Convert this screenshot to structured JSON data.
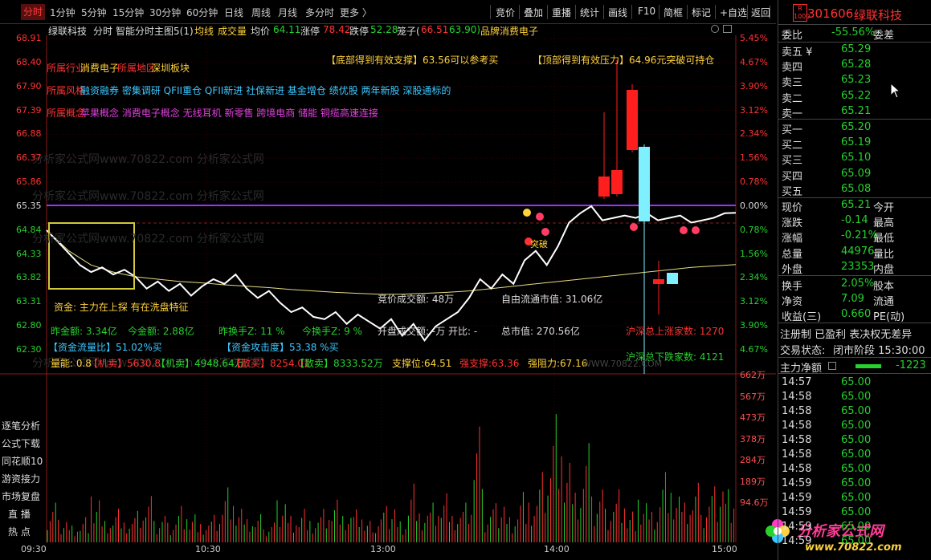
{
  "topbar": {
    "tabs": [
      "分时",
      "1分钟",
      "5分钟",
      "15分钟",
      "30分钟",
      "60分钟",
      "日线",
      "周线",
      "月线",
      "多分时",
      "更多 〉"
    ],
    "tools": [
      "竞价",
      "叠加",
      "重播",
      "统计",
      "画线",
      "F10",
      "简框",
      "标记",
      "+自选",
      "返回"
    ]
  },
  "info": {
    "stock_name": "绿联科技",
    "mode": "分时",
    "indicator": "智能分时主图5(1)",
    "avg_line": "均线",
    "vol_label": "成交量",
    "avg_price_label": "均价",
    "avg_price": "64.11",
    "limit_up_label": "涨停",
    "limit_up": "78.42",
    "limit_down_label": "跌停",
    "limit_down": "52.28",
    "cage_label": "笼子(",
    "cage_low": "66.51",
    "cage_high": "63.90)",
    "brand": "品牌消费电子"
  },
  "price_axis_left": [
    "68.91",
    "68.40",
    "67.90",
    "67.39",
    "66.88",
    "66.37",
    "65.86",
    "65.35",
    "64.84",
    "64.33",
    "63.82",
    "63.31",
    "62.80",
    "62.30"
  ],
  "pct_axis_right": [
    "5.45%",
    "4.67%",
    "3.90%",
    "3.12%",
    "2.34%",
    "1.56%",
    "0.78%",
    "0.00%",
    "0.78%",
    "1.56%",
    "2.34%",
    "3.12%",
    "3.90%",
    "4.67%"
  ],
  "vol_axis": [
    "662万",
    "567万",
    "473万",
    "378万",
    "284万",
    "189万",
    "94.6万"
  ],
  "time_axis": [
    "09:30",
    "10:30",
    "13:00",
    "14:00",
    "15:00"
  ],
  "annotations": {
    "industry_label": "所属行业",
    "industry": "消费电子",
    "region_label": "所属地区",
    "region": "深圳板块",
    "style_label": "所属风格",
    "styles": "融资融券 密集调研 QFII重仓 QFII新进 社保新进 基金增仓 绩优股 两年新股 深股通标的",
    "concept_label": "所属概念",
    "concepts": "苹果概念 消费电子概念 无线耳机 新零售 跨境电商 储能 铜缆高速连接",
    "support_text": "【底部得到有效支撑】63.56可以参考买",
    "pressure_text": "【顶部得到有效压力】64.96元突破可持仓",
    "fund_text": "资金: 主力在上探  有在洗盘特征",
    "today_amount": "昨金额: 3.34亿",
    "today_amount2": "今金额: 2.88亿",
    "yest_turnover": "昨换手Z: 11 %",
    "today_turnover": "今换手Z: 9 %",
    "fund_flow": "【资金流量比】51.02%买",
    "fund_attack": "【资金攻击度】53.38 %买",
    "vol_ratio": "量能: 0.8",
    "big_sell": "【机卖】5630.8",
    "big_buy": "【机卖】4948.64万",
    "retail_buy": "【散买】8254.01",
    "retail_sell": "【散卖】8333.52万",
    "support_line": "支撑位:64.51",
    "strong_support": "强支撑:63.36",
    "strong_resist": "强阻力:67.16",
    "auction_amount": "竞价成交额: 48万",
    "open_amount": "开盘成交额: -万 开比: -",
    "float_value": "自由流通市值: 31.06亿",
    "total_value": "总市值: 270.56亿",
    "up_count": "沪深总上涨家数: 1270",
    "down_count": "沪深总下跌家数: 4121",
    "breakout": "突破",
    "watermark_url": "WWW.70822.COM",
    "watermark": "分析家公式网www.70822.com 分析家公式网"
  },
  "left_menu": [
    "逐笔分析",
    "公式下载",
    "同花顺10",
    "游资接力",
    "市场复盘",
    "直 播",
    "热 点"
  ],
  "right_panel": {
    "code": "301606",
    "name": "绿联科技",
    "ratio_label": "委比",
    "ratio": "-55.56%",
    "diff_label": "委差",
    "asks": [
      {
        "label": "卖五 ¥",
        "price": "65.29"
      },
      {
        "label": "卖四",
        "price": "65.28"
      },
      {
        "label": "卖三",
        "price": "65.23"
      },
      {
        "label": "卖二",
        "price": "65.22"
      },
      {
        "label": "卖一",
        "price": "65.21"
      }
    ],
    "bids": [
      {
        "label": "买一",
        "price": "65.20"
      },
      {
        "label": "买二",
        "price": "65.19"
      },
      {
        "label": "买三",
        "price": "65.10"
      },
      {
        "label": "买四",
        "price": "65.09"
      },
      {
        "label": "买五",
        "price": "65.08"
      }
    ],
    "stats": [
      {
        "k": "现价",
        "v": "65.21",
        "k2": "今开"
      },
      {
        "k": "涨跌",
        "v": "-0.14",
        "k2": "最高"
      },
      {
        "k": "涨幅",
        "v": "-0.21%",
        "k2": "最低"
      },
      {
        "k": "总量",
        "v": "44976",
        "k2": "量比"
      },
      {
        "k": "外盘",
        "v": "23353",
        "k2": "内盘"
      }
    ],
    "stats2": [
      {
        "k": "换手",
        "v": "2.05%",
        "k2": "股本"
      },
      {
        "k": "净资",
        "v": "7.09",
        "k2": "流通"
      },
      {
        "k": "收益(三)",
        "v": "0.660",
        "k2": "PE(动)"
      }
    ],
    "tags": "注册制 已盈利 表决权无差异",
    "trade_status_label": "交易状态:",
    "trade_status": "闭市阶段 15:30:00",
    "net_label": "主力净额",
    "net_value": "-1223",
    "ticks": [
      {
        "t": "14:57",
        "p": "65.00"
      },
      {
        "t": "14:58",
        "p": "65.00"
      },
      {
        "t": "14:58",
        "p": "65.00"
      },
      {
        "t": "14:58",
        "p": "65.00"
      },
      {
        "t": "14:58",
        "p": "65.00"
      },
      {
        "t": "14:58",
        "p": "65.00"
      },
      {
        "t": "14:58",
        "p": "65.00"
      },
      {
        "t": "14:59",
        "p": "65.00"
      },
      {
        "t": "14:59",
        "p": "65.00"
      },
      {
        "t": "14:59",
        "p": "65.00"
      },
      {
        "t": "14:59",
        "p": "65.00"
      },
      {
        "t": "14:59",
        "p": "65.00"
      }
    ]
  },
  "logo": {
    "text": "分析家公式网",
    "url": "www.70822.com"
  },
  "colors": {
    "up": "#ff3232",
    "down": "#27d12e",
    "yellow": "#ffd23c",
    "cyan": "#3cc8ff",
    "magenta": "#e040e0",
    "baseline": "#9933ff"
  },
  "chart_data": {
    "type": "line",
    "title": "",
    "price_series": [
      64.84,
      64.6,
      64.35,
      64.1,
      63.95,
      64.05,
      63.9,
      64.0,
      63.85,
      63.6,
      63.75,
      63.55,
      63.7,
      63.45,
      63.65,
      63.8,
      63.7,
      63.9,
      63.6,
      63.4,
      63.55,
      63.3,
      63.1,
      63.2,
      63.0,
      62.95,
      63.1,
      62.85,
      63.05,
      62.9,
      62.75,
      62.95,
      62.6,
      62.85,
      62.5,
      62.8,
      62.95,
      63.1,
      63.4,
      63.8,
      63.6,
      63.9,
      63.7,
      64.2,
      64.4,
      64.1,
      64.5,
      65.0,
      65.2,
      65.35,
      65.05,
      65.1,
      65.15,
      65.1,
      65.2,
      65.05,
      65.1,
      65.15,
      65.0,
      65.05,
      65.1,
      65.2,
      65.21
    ],
    "avg_series": [
      64.84,
      64.4,
      64.1,
      63.95,
      63.85,
      63.8,
      63.75,
      63.72,
      63.68,
      63.65,
      63.62,
      63.58,
      63.55,
      63.52,
      63.5,
      63.48,
      63.48,
      63.5,
      63.52,
      63.55,
      63.6,
      63.65,
      63.7,
      63.75,
      63.8,
      63.85,
      63.9,
      63.95,
      64.0,
      64.05,
      64.08,
      64.11
    ],
    "ylim": [
      62.3,
      68.91
    ],
    "x_ticks": [
      "09:30",
      "10:30",
      "13:00",
      "14:00",
      "15:00"
    ],
    "volume": [
      120,
      80,
      60,
      90,
      150,
      70,
      110,
      60,
      95,
      140,
      80,
      70,
      130,
      100,
      60,
      90,
      180,
      110,
      70,
      85,
      60,
      150,
      95,
      120,
      70,
      110,
      140,
      80,
      100,
      65,
      90,
      130,
      75,
      210,
      95,
      130,
      160,
      80,
      120,
      350,
      100,
      140,
      90,
      180,
      130,
      230,
      420,
      260,
      150,
      300,
      160,
      120,
      190,
      110,
      140,
      100,
      230,
      150,
      120,
      180,
      140,
      200,
      190
    ],
    "vol_ylim": [
      0,
      662
    ]
  }
}
